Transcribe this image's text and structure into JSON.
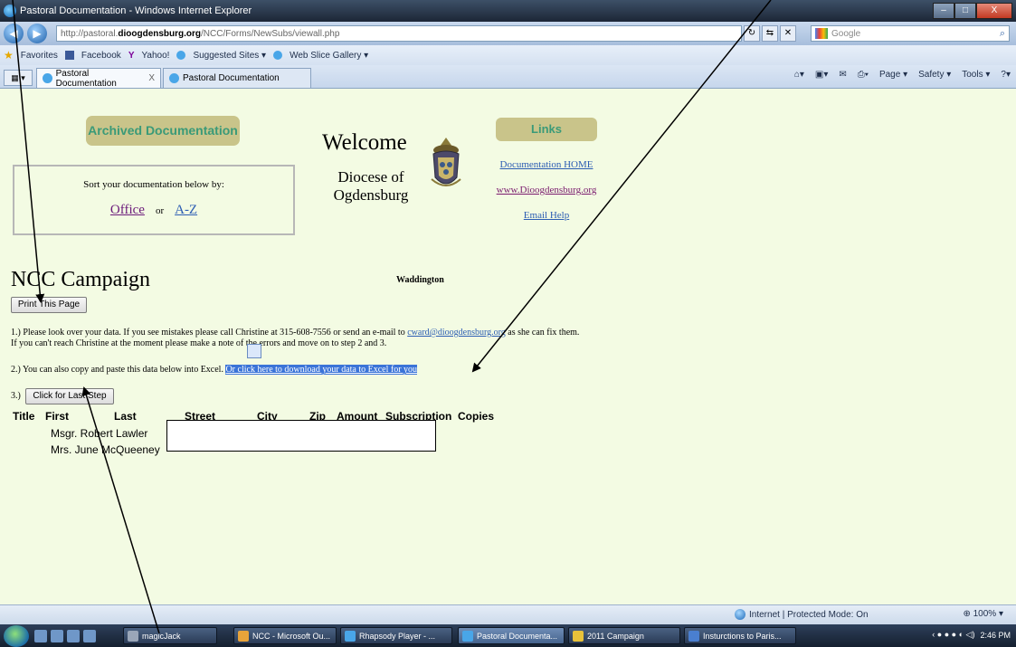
{
  "window": {
    "title": "Pastoral Documentation - Windows Internet Explorer",
    "controls": [
      "–",
      "□",
      "X"
    ]
  },
  "address_bar": {
    "url_prefix": "http://pastoral.",
    "url_domain": "dioogdensburg.org",
    "url_path": "/NCC/Forms/NewSubs/viewall.php",
    "search_engine": "Google",
    "nav_back": "◀",
    "nav_forward": "▶",
    "search_icon": "⌕"
  },
  "favorites_bar": {
    "favorites": "Favorites",
    "items": [
      "Facebook",
      "Yahoo!",
      "Suggested Sites ▾",
      "Web Slice Gallery ▾"
    ]
  },
  "tabs": [
    {
      "label": "Pastoral Documentation",
      "close": "X"
    },
    {
      "label": "Pastoral Documentation"
    }
  ],
  "command_bar": [
    "Page ▾",
    "Safety ▾",
    "Tools ▾"
  ],
  "page": {
    "archived_button": "Archived Documentation",
    "sort_label": "Sort your documentation below by:",
    "sort_office": "Office",
    "sort_or": "or",
    "sort_az": "A-Z",
    "welcome": "Welcome",
    "diocese_line1": "Diocese of",
    "diocese_line2": "Ogdensburg",
    "links_button": "Links",
    "link_documentation_home": "Documentation HOME",
    "link_site": "www.Dioogdensburg.org",
    "link_email_help": "Email Help",
    "campaign_title": "NCC Campaign",
    "parish": "Waddington",
    "print_button": "Print This Page",
    "step1_a": "1.) Please look over your data. If you see mistakes please call Christine at 315-608-7556 or send an e-mail to",
    "step1_email": "cward@dioogdensburg.org",
    "step1_b": "as she can fix them.",
    "step1_c": "If you can't reach Christine at the moment please make a note of the errors and move on to step 2 and 3.",
    "step2_a": "2.) You can also copy and paste this data below into Excel.",
    "step2_link": "Or click here to download your data to Excel for you",
    "step3_label": "3.)",
    "last_step_button": "Click for Last Step",
    "columns": [
      "Title",
      "First",
      "Last",
      "Street",
      "City",
      "Zip",
      "Amount",
      "Subscription",
      "Copies"
    ],
    "rows": [
      {
        "name": "Msgr. Robert Lawler"
      },
      {
        "name": "Mrs. June    McQueeney"
      }
    ]
  },
  "status_bar": {
    "zone": "Internet | Protected Mode: On",
    "zoom": "100%"
  },
  "taskbar": {
    "items": [
      "magicJack",
      "NCC - Microsoft Ou...",
      "Rhapsody Player - ...",
      "Pastoral Documenta...",
      "2011 Campaign",
      "Insturctions to Paris..."
    ],
    "clock": "2:46 PM"
  },
  "icons": [
    "ie-icon",
    "back-icon",
    "forward-icon",
    "google-icon",
    "search-icon",
    "favorites-star-icon",
    "home-icon",
    "print-icon",
    "help-icon",
    "globe-icon",
    "start-icon"
  ]
}
